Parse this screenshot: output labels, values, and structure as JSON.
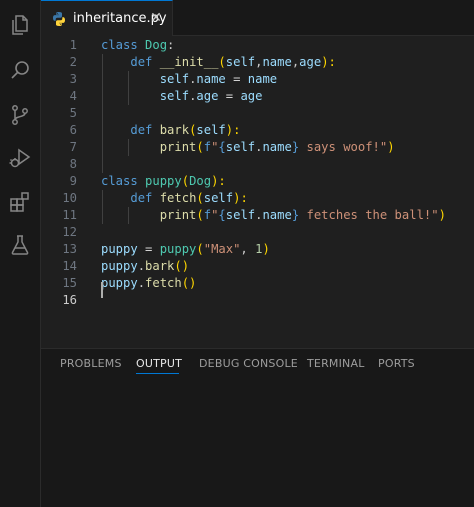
{
  "activity_bar": {
    "icons": [
      "files-icon",
      "search-icon",
      "source-control-icon",
      "run-debug-icon",
      "extensions-icon",
      "testing-icon"
    ]
  },
  "tab": {
    "filename": "inheritance.py",
    "close_glyph": "✕"
  },
  "editor": {
    "line_numbers": [
      "1",
      "2",
      "3",
      "4",
      "5",
      "6",
      "7",
      "8",
      "9",
      "10",
      "11",
      "12",
      "13",
      "14",
      "15",
      "16"
    ],
    "active_line": "16"
  },
  "code": {
    "l1": {
      "kw": "class",
      "name": "Dog",
      "colon": ":"
    },
    "l2": {
      "kw": "def",
      "name": "__init__",
      "open": "(",
      "self": "self",
      "c1": ",",
      "p1": "name",
      "c2": ",",
      "p2": "age",
      "close": "):"
    },
    "l3": {
      "self": "self",
      "dot": ".",
      "attr": "name",
      "eq": " = ",
      "val": "name"
    },
    "l4": {
      "self": "self",
      "dot": ".",
      "attr": "age",
      "eq": " = ",
      "val": "age"
    },
    "l6": {
      "kw": "def",
      "name": "bark",
      "open": "(",
      "self": "self",
      "close": "):"
    },
    "l7": {
      "fn": "print",
      "open": "(",
      "f": "f",
      "q1": "\"",
      "lb": "{",
      "self": "self",
      "dot": ".",
      "attr": "name",
      "rb": "}",
      "rest": " says woof!\"",
      "close": ")"
    },
    "l9": {
      "kw": "class",
      "name": "puppy",
      "open": "(",
      "base": "Dog",
      "close": "):"
    },
    "l10": {
      "kw": "def",
      "name": "fetch",
      "open": "(",
      "self": "self",
      "close": "):"
    },
    "l11": {
      "fn": "print",
      "open": "(",
      "f": "f",
      "q1": "\"",
      "lb": "{",
      "self": "self",
      "dot": ".",
      "attr": "name",
      "rb": "}",
      "rest": " fetches the ball!\"",
      "close": ")"
    },
    "l13": {
      "var": "puppy",
      "eq": " = ",
      "cls": "puppy",
      "open": "(",
      "str": "\"Max\"",
      "comma": ", ",
      "num": "1",
      "close": ")"
    },
    "l14": {
      "var": "puppy",
      "dot": ".",
      "fn": "bark",
      "parens": "()"
    },
    "l15": {
      "var": "puppy",
      "dot": ".",
      "fn": "fetch",
      "parens": "()"
    }
  },
  "panel": {
    "tabs": [
      "PROBLEMS",
      "OUTPUT",
      "DEBUG CONSOLE",
      "TERMINAL",
      "PORTS"
    ],
    "active_tab": "OUTPUT"
  },
  "colors": {
    "keyword": "#569cd6",
    "class": "#4ec9b0",
    "function": "#dcdcaa",
    "variable": "#9cdcfe",
    "string": "#ce9178",
    "number": "#b5cea8",
    "accent": "#0078d4"
  }
}
